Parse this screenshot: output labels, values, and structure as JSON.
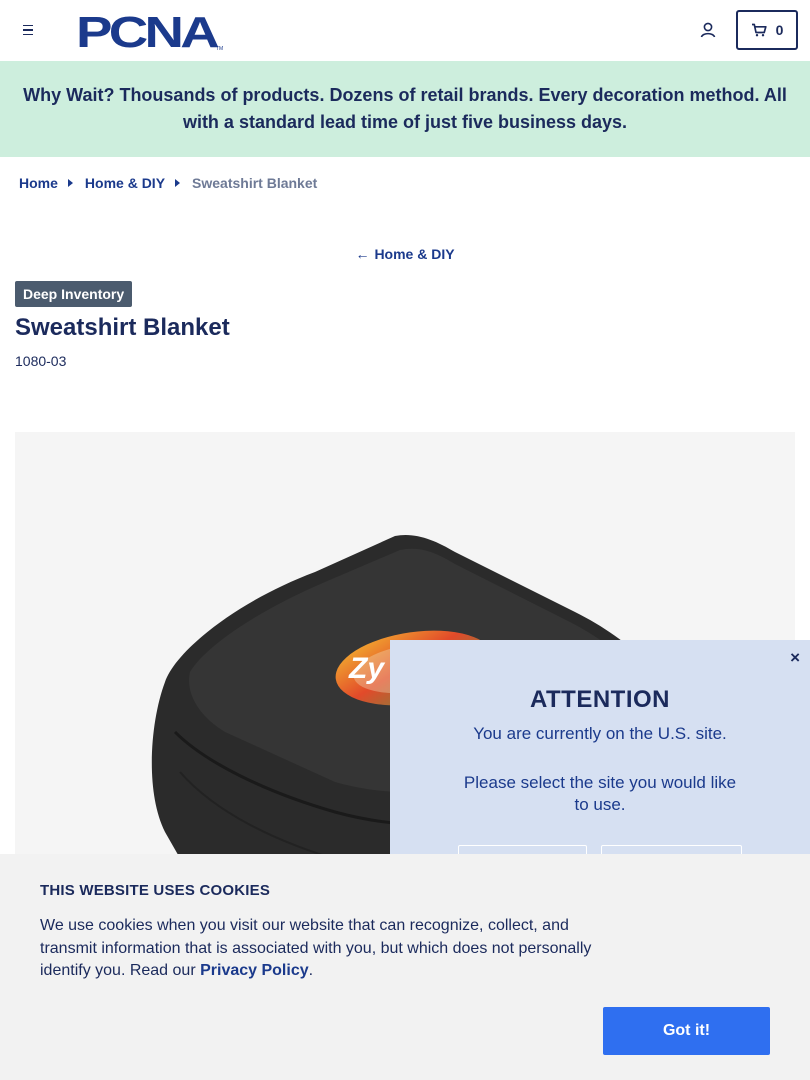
{
  "header": {
    "logo_text": "PCNA",
    "logo_tm": "TM",
    "cart_count": "0",
    "brand_color": "#1b3a8c"
  },
  "promo": {
    "text": "Why Wait? Thousands of products. Dozens of retail brands. Every decoration method. All with a standard lead time of just five business days.",
    "background": "#cdeedd"
  },
  "breadcrumb": {
    "items": [
      "Home",
      "Home & DIY"
    ],
    "current": "Sweatshirt Blanket"
  },
  "back_link": "Home & DIY",
  "product": {
    "badge": "Deep Inventory",
    "title": "Sweatshirt Blanket",
    "sku": "1080-03",
    "logo_fragment": "Zy"
  },
  "modal": {
    "close": "×",
    "title": "ATTENTION",
    "line1": "You are currently on the U.S. site.",
    "line2": "Please select the site you would like to use."
  },
  "cookie": {
    "title": "THIS WEBSITE USES COOKIES",
    "text_before": "We use cookies when you visit our website that can recognize, collect, and transmit information that is associated with you, but which does not personally identify you. Read our ",
    "link": "Privacy Policy",
    "text_after": ".",
    "button": "Got it!",
    "button_color": "#2f6ff0"
  }
}
